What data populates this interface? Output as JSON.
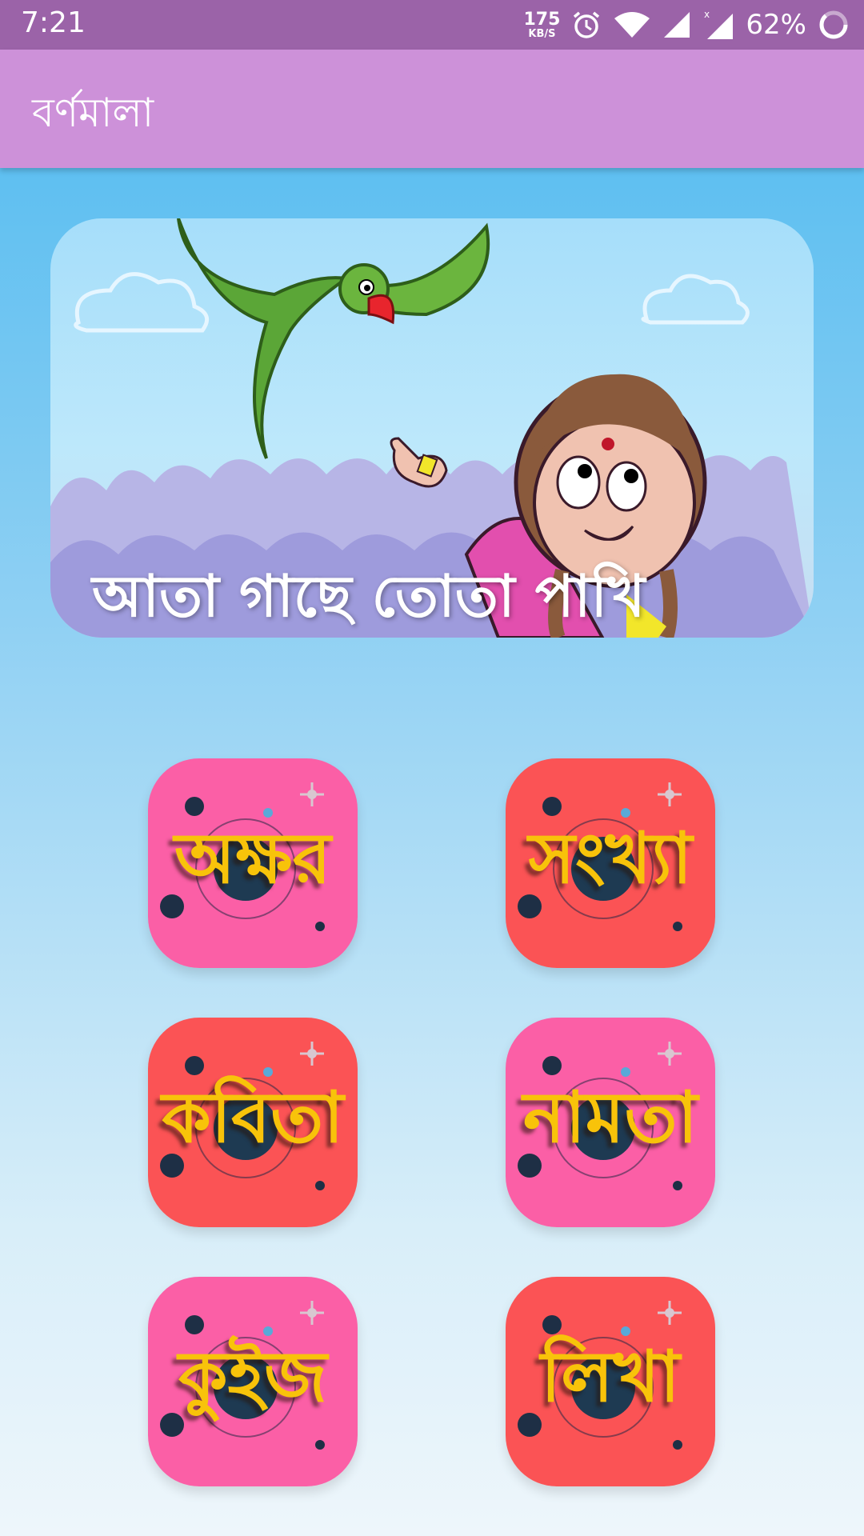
{
  "status_bar": {
    "time": "7:21",
    "net_speed_value": "175",
    "net_speed_unit": "KB/S",
    "battery": "62%",
    "icons": [
      "alarm-icon",
      "wifi-icon",
      "signal-icon",
      "signal-x-icon",
      "battery-icon"
    ]
  },
  "app_bar": {
    "title": "বর্ণমালা"
  },
  "banner": {
    "caption": "আতা গাছে তোতা পাখি"
  },
  "menu": [
    {
      "label": "অক্ষর",
      "color": "#fb5fa6"
    },
    {
      "label": "সংখ্যা",
      "color": "#fb5355"
    },
    {
      "label": "কবিতা",
      "color": "#fb5355"
    },
    {
      "label": "নামতা",
      "color": "#fb5fa6"
    },
    {
      "label": "কুইজ",
      "color": "#fb5fa6"
    },
    {
      "label": "লিখা",
      "color": "#fb5355"
    }
  ],
  "colors": {
    "status_bar": "#9b63a8",
    "app_bar": "#cd91d9",
    "label_yellow": "#f8c30a"
  }
}
